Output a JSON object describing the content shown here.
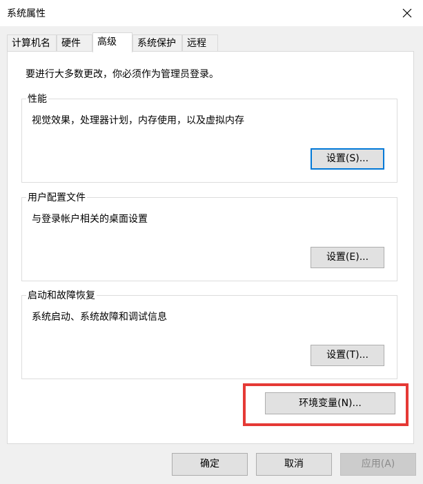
{
  "window": {
    "title": "系统属性"
  },
  "tabs": [
    {
      "label": "计算机名"
    },
    {
      "label": "硬件"
    },
    {
      "label": "高级"
    },
    {
      "label": "系统保护"
    },
    {
      "label": "远程"
    }
  ],
  "advanced": {
    "admin_note": "要进行大多数更改，你必须作为管理员登录。",
    "performance": {
      "title": "性能",
      "description": "视觉效果，处理器计划，内存使用，以及虚拟内存",
      "button": "设置(S)..."
    },
    "user_profiles": {
      "title": "用户配置文件",
      "description": "与登录帐户相关的桌面设置",
      "button": "设置(E)..."
    },
    "startup_recovery": {
      "title": "启动和故障恢复",
      "description": "系统启动、系统故障和调试信息",
      "button": "设置(T)..."
    },
    "env_button": "环境变量(N)..."
  },
  "footer": {
    "ok": "确定",
    "cancel": "取消",
    "apply": "应用(A)"
  },
  "colors": {
    "highlight": "#e53935",
    "focus": "#0078d7"
  }
}
